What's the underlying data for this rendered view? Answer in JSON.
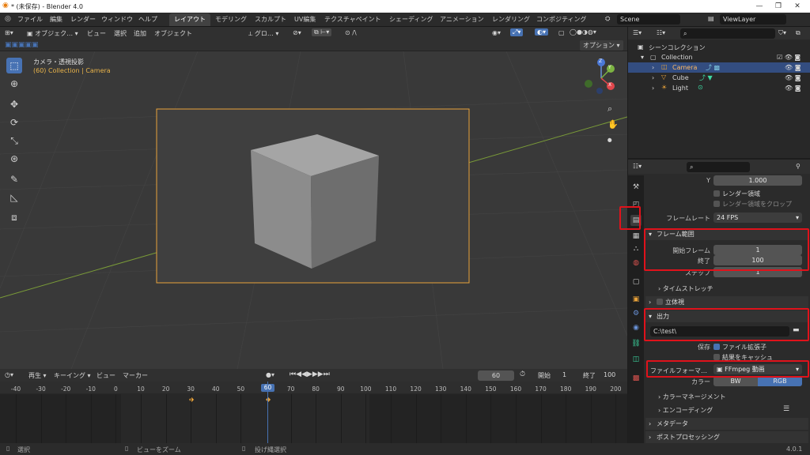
{
  "window": {
    "title": "* (未保存) - Blender 4.0",
    "controls": [
      "—",
      "❐",
      "✕"
    ]
  },
  "menus": [
    "ファイル",
    "編集",
    "レンダー",
    "ウィンドウ",
    "ヘルプ"
  ],
  "workspaces": [
    "レイアウト",
    "モデリング",
    "スカルプト",
    "UV編集",
    "テクスチャペイント",
    "シェーディング",
    "アニメーション",
    "レンダリング",
    "コンポジティング"
  ],
  "scene": {
    "name": "Scene",
    "view_layer": "ViewLayer"
  },
  "viewport_header": {
    "mode": "オブジェク…",
    "menus": [
      "ビュー",
      "選択",
      "追加",
      "オブジェクト"
    ],
    "transform": "グロ…",
    "options": "オプション"
  },
  "viewport": {
    "view_name": "カメラ・透視投影",
    "collection_info": "(60) Collection | Camera",
    "axis_labels": {
      "z": "Z",
      "y": "Y",
      "x": "X"
    }
  },
  "outliner": {
    "root": "シーンコレクション",
    "collection": "Collection",
    "items": [
      {
        "name": "Camera",
        "selected": true
      },
      {
        "name": "Cube",
        "selected": false
      },
      {
        "name": "Light",
        "selected": false
      }
    ]
  },
  "properties": {
    "y_label": "Y",
    "y_value": "1.000",
    "render_region": "レンダー領域",
    "crop_region": "レンダー領域をクロップ",
    "frame_rate_label": "フレームレート",
    "frame_rate": "24 FPS",
    "frame_range_panel": "フレーム範囲",
    "start_label": "開始フレーム",
    "start_value": "1",
    "end_label": "終了",
    "end_value": "100",
    "step_label": "ステップ",
    "step_value": "1",
    "time_stretch": "タイムストレッチ",
    "stereo": "立体視",
    "output_panel": "出力",
    "output_path": "C:\\test\\",
    "save_label": "保存",
    "file_extension": "ファイル拡張子",
    "cache_result": "結果をキャッシュ",
    "file_format_label": "ファイルフォーマ…",
    "file_format": "FFmpeg 動画",
    "color_label": "カラー",
    "color_bw": "BW",
    "color_rgb": "RGB",
    "color_management": "カラーマネージメント",
    "encoding": "エンコーディング",
    "metadata": "メタデータ",
    "post_processing": "ポストプロセッシング"
  },
  "timeline": {
    "menus": [
      "再生",
      "キーイング",
      "ビュー",
      "マーカー"
    ],
    "current_frame": "60",
    "start_label": "開始",
    "start": "1",
    "end_label": "終了",
    "end": "100",
    "ticks": [
      "-40",
      "-30",
      "-20",
      "-10",
      "0",
      "10",
      "20",
      "30",
      "40",
      "50",
      "60",
      "70",
      "80",
      "90",
      "100",
      "110",
      "120",
      "130",
      "140",
      "150",
      "160",
      "170",
      "180",
      "190",
      "200"
    ],
    "playhead": "60"
  },
  "statusbar": {
    "select": "選択",
    "zoom": "ビューをズーム",
    "lasso": "投げ縄選択",
    "version": "4.0.1"
  }
}
